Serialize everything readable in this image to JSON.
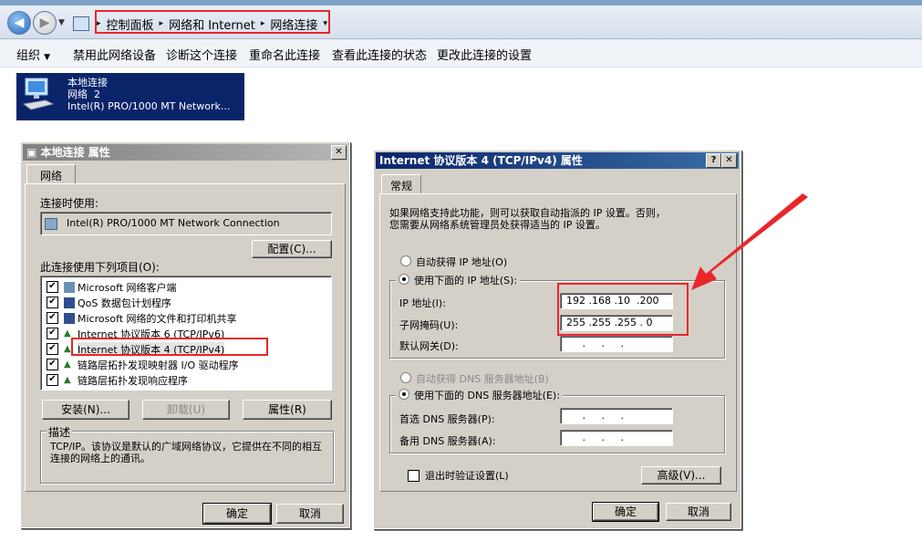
{
  "breadcrumbs": [
    "控制面板",
    "网络和 Internet",
    "网络连接"
  ],
  "commands": [
    "组织",
    "禁用此网络设备",
    "诊断这个连接",
    "重命名此连接",
    "查看此连接的状态",
    "更改此连接的设置"
  ],
  "connection": {
    "name": "本地连接",
    "network": "网络  2",
    "adapter": "Intel(R) PRO/1000 MT Network..."
  },
  "props": {
    "title": "本地连接 属性",
    "tab": "网络",
    "connect_using_label": "连接时使用:",
    "adapter": "Intel(R) PRO/1000 MT Network Connection",
    "configure_button": "配置(C)...",
    "items_label": "此连接使用下列项目(O):",
    "items": [
      "Microsoft 网络客户端",
      "QoS 数据包计划程序",
      "Microsoft 网络的文件和打印机共享",
      "Internet 协议版本 6 (TCP/IPv6)",
      "Internet 协议版本 4 (TCP/IPv4)",
      "链路层拓扑发现映射器 I/O 驱动程序",
      "链路层拓扑发现响应程序"
    ],
    "install_button": "安装(N)...",
    "uninstall_button": "卸载(U)",
    "properties_button": "属性(R)",
    "description_label": "描述",
    "description_text": "TCP/IP。该协议是默认的广域网络协议，它提供在不同的相互连接的网络上的通讯。",
    "ok_button": "确定",
    "cancel_button": "取消"
  },
  "ipv4": {
    "title": "Internet 协议版本 4 (TCP/IPv4) 属性",
    "help": "?",
    "tab": "常规",
    "intro_line1": "如果网络支持此功能，则可以获取自动指派的 IP 设置。否则，",
    "intro_line2": "您需要从网络系统管理员处获得适当的 IP 设置。",
    "auto_ip": "自动获得 IP 地址(O)",
    "manual_ip": "使用下面的 IP 地址(S):",
    "ip_label": "IP 地址(I):",
    "ip_value": "192 .168 .10  .200",
    "mask_label": "子网掩码(U):",
    "mask_value": "255 .255 .255 . 0",
    "gateway_label": "默认网关(D):",
    "gateway_value": "     .     .     .",
    "auto_dns": "自动获得 DNS 服务器地址(B)",
    "manual_dns": "使用下面的 DNS 服务器地址(E):",
    "dns1_label": "首选 DNS 服务器(P):",
    "dns1_value": "     .     .     .",
    "dns2_label": "备用 DNS 服务器(A):",
    "dns2_value": "     .     .     .",
    "validate_label": "退出时验证设置(L)",
    "advanced_button": "高级(V)...",
    "ok_button": "确定",
    "cancel_button": "取消"
  },
  "colors": {
    "highlight": "#e8262a",
    "selection": "#0a246a",
    "dialog": "#d4d0c8"
  }
}
